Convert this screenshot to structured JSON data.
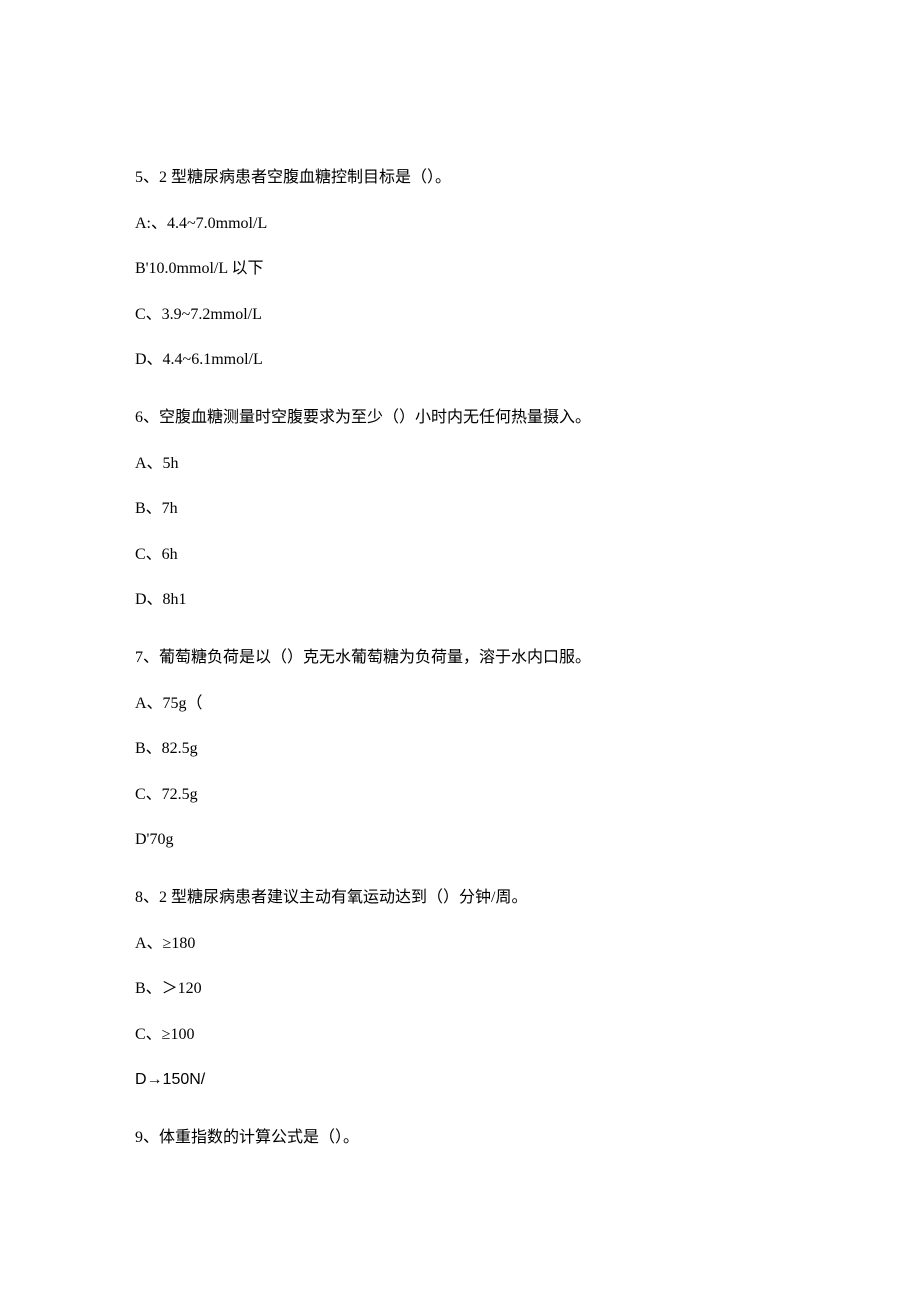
{
  "questions": [
    {
      "stem": "5、2 型糖尿病患者空腹血糖控制目标是（）。",
      "options": [
        "A:、4.4~7.0mmol/L",
        "B'10.0mmol/L 以下",
        "C、3.9~7.2mmol/L",
        "D、4.4~6.1mmol/L"
      ]
    },
    {
      "stem": "6、空腹血糖测量时空腹要求为至少（）小时内无任何热量摄入。",
      "options": [
        "A、5h",
        "B、7h",
        "C、6h",
        "D、8h1"
      ]
    },
    {
      "stem": "7、葡萄糖负荷是以（）克无水葡萄糖为负荷量，溶于水内口服。",
      "options": [
        "A、75g（",
        "B、82.5g",
        "C、72.5g",
        "D'70g"
      ]
    },
    {
      "stem": "8、2 型糖尿病患者建议主动有氧运动达到（）分钟/周。",
      "options": [
        "A、≥180",
        "B、＞120",
        "C、≥100",
        "D→150N/"
      ]
    },
    {
      "stem": "9、体重指数的计算公式是（）。",
      "options": []
    }
  ]
}
